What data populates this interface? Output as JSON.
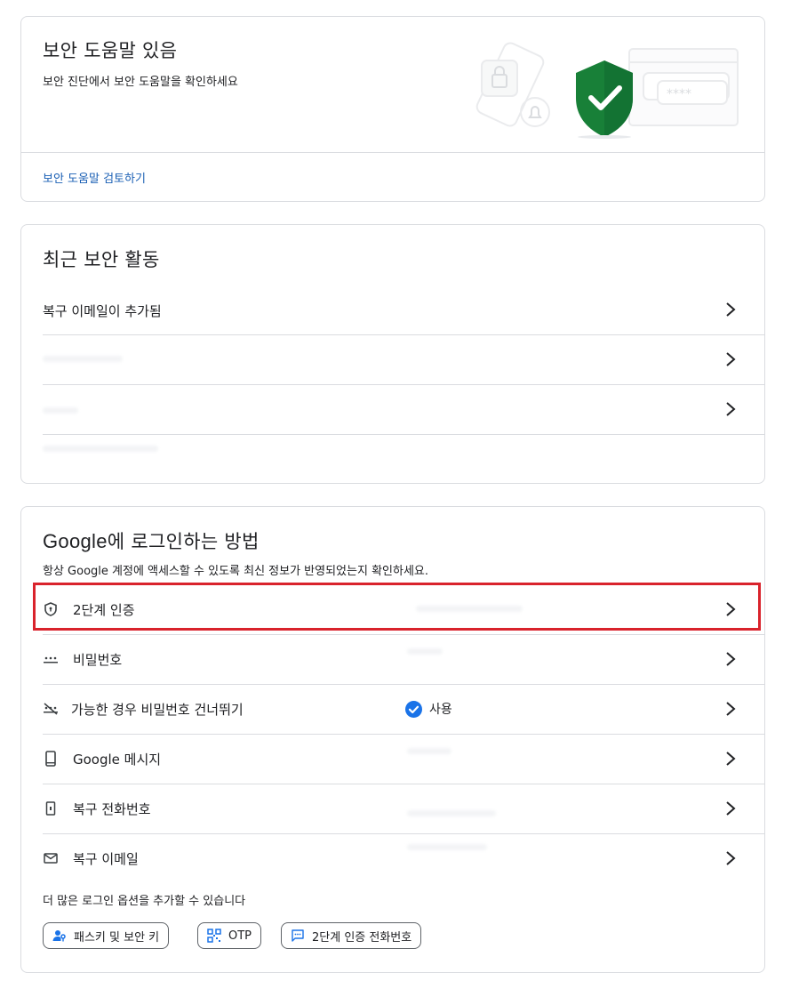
{
  "security_tips": {
    "title": "보안 도움말 있음",
    "subtitle": "보안 진단에서 보안 도움말을 확인하세요",
    "link": "보안 도움말 검토하기"
  },
  "recent_activity": {
    "title": "최근 보안 활동",
    "items": [
      {
        "label": "복구 이메일이 추가됨"
      },
      {
        "label": ""
      },
      {
        "label": ""
      }
    ]
  },
  "signin_methods": {
    "title_brand": "Google",
    "title_rest": "에 로그인하는 방법",
    "subtitle": "항상 Google 계정에 액세스할 수 있도록 최신 정보가 반영되었는지 확인하세요.",
    "items": [
      {
        "label": "2단계 인증",
        "icon": "shield-icon"
      },
      {
        "label": "비밀번호",
        "icon": "password-dots-icon"
      },
      {
        "label": "가능한 경우 비밀번호 건너뛰기",
        "icon": "skip-password-icon",
        "status": "사용"
      },
      {
        "label": "Google 메시지",
        "icon": "phone-icon"
      },
      {
        "label": "복구 전화번호",
        "icon": "phone-outline-icon"
      },
      {
        "label": "복구 이메일",
        "icon": "mail-icon"
      }
    ],
    "more_options": "더 많은 로그인 옵션을 추가할 수 있습니다",
    "chips": [
      {
        "label": "패스키 및 보안 키",
        "icon": "person-key-icon"
      },
      {
        "label": "OTP",
        "icon": "qr-code-icon"
      },
      {
        "label": "2단계 인증 전화번호",
        "icon": "message-icon"
      }
    ]
  },
  "colors": {
    "accent": "#1a73e8",
    "link": "#1a5fb4",
    "shield_green": "#188038",
    "highlight_red": "#d9232c"
  }
}
